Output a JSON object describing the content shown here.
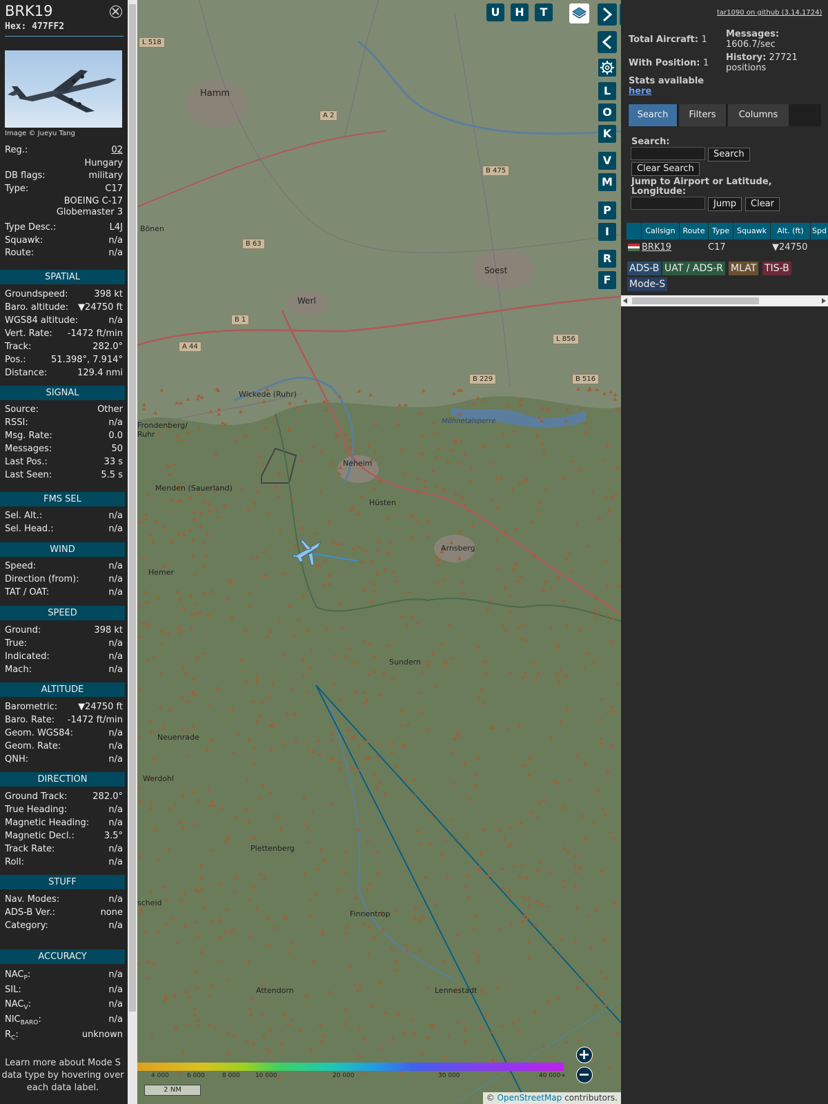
{
  "aircraft": {
    "callsign": "BRK19",
    "hex_label": "Hex:",
    "hex": "477FF2",
    "image_credit": "Image © Jueyu Tang"
  },
  "info": {
    "reg_label": "Reg.:",
    "reg_value": "02",
    "country": "Hungary",
    "dbflags_label": "DB flags:",
    "dbflags_value": "military",
    "type_label": "Type:",
    "type_value": "C17",
    "type_name_1": "BOEING C-17",
    "type_name_2": "Globemaster 3",
    "typedesc_label": "Type Desc.:",
    "typedesc_value": "L4J",
    "squawk_label": "Squawk:",
    "squawk_value": "n/a",
    "route_label": "Route:",
    "route_value": "n/a"
  },
  "sections": {
    "spatial": "SPATIAL",
    "signal": "SIGNAL",
    "fmssel": "FMS SEL",
    "wind": "WIND",
    "speed": "SPEED",
    "altitude": "ALTITUDE",
    "direction": "DIRECTION",
    "stuff": "STUFF",
    "accuracy": "ACCURACY"
  },
  "spatial": [
    {
      "k": "Groundspeed:",
      "v": "398 kt"
    },
    {
      "k": "Baro. altitude:",
      "v": "▼24750 ft"
    },
    {
      "k": "WGS84 altitude:",
      "v": "n/a"
    },
    {
      "k": "Vert. Rate:",
      "v": "-1472 ft/min"
    },
    {
      "k": "Track:",
      "v": "282.0°"
    },
    {
      "k": "Pos.:",
      "v": "51.398°, 7.914°"
    },
    {
      "k": "Distance:",
      "v": "129.4 nmi"
    }
  ],
  "signal": [
    {
      "k": "Source:",
      "v": "Other"
    },
    {
      "k": "RSSI:",
      "v": "n/a"
    },
    {
      "k": "Msg. Rate:",
      "v": "0.0"
    },
    {
      "k": "Messages:",
      "v": "50"
    },
    {
      "k": "Last Pos.:",
      "v": "33 s"
    },
    {
      "k": "Last Seen:",
      "v": "5.5 s"
    }
  ],
  "fmssel": [
    {
      "k": "Sel. Alt.:",
      "v": "n/a"
    },
    {
      "k": "Sel. Head.:",
      "v": "n/a"
    }
  ],
  "wind": [
    {
      "k": "Speed:",
      "v": "n/a"
    },
    {
      "k": "Direction (from):",
      "v": "n/a"
    },
    {
      "k": "TAT / OAT:",
      "v": "n/a"
    }
  ],
  "speed": [
    {
      "k": "Ground:",
      "v": "398 kt"
    },
    {
      "k": "True:",
      "v": "n/a"
    },
    {
      "k": "Indicated:",
      "v": "n/a"
    },
    {
      "k": "Mach:",
      "v": "n/a"
    }
  ],
  "altitude": [
    {
      "k": "Barometric:",
      "v": "▼24750 ft"
    },
    {
      "k": "Baro. Rate:",
      "v": "-1472 ft/min"
    },
    {
      "k": "Geom. WGS84:",
      "v": "n/a"
    },
    {
      "k": "Geom. Rate:",
      "v": "n/a"
    },
    {
      "k": "QNH:",
      "v": "n/a"
    }
  ],
  "direction": [
    {
      "k": "Ground Track:",
      "v": "282.0°"
    },
    {
      "k": "True Heading:",
      "v": "n/a"
    },
    {
      "k": "Magnetic Heading:",
      "v": "n/a"
    },
    {
      "k": "Magnetic Decl.:",
      "v": "3.5°"
    },
    {
      "k": "Track Rate:",
      "v": "n/a"
    },
    {
      "k": "Roll:",
      "v": "n/a"
    }
  ],
  "stuff": [
    {
      "k": "Nav. Modes:",
      "v": "n/a"
    },
    {
      "k": "ADS-B Ver.:",
      "v": "none"
    },
    {
      "k": "Category:",
      "v": "n/a"
    }
  ],
  "accuracy": [
    {
      "k": "NACP:",
      "v": "n/a"
    },
    {
      "k": "SIL:",
      "v": "n/a"
    },
    {
      "k": "NACV:",
      "v": "n/a"
    },
    {
      "k": "NICBARO:",
      "v": "n/a"
    },
    {
      "k": "RC:",
      "v": "unknown"
    }
  ],
  "accuracy_labels": {
    "nacp_main": "NAC",
    "nacp_sub": "P",
    "nacv_main": "NAC",
    "nacv_sub": "V",
    "nic_main": "NIC",
    "nic_sub": "BARO",
    "rc_main": "R",
    "rc_sub": "C"
  },
  "footnote": "Learn more about Mode S data type by hovering over each data label.",
  "map": {
    "toolbar": [
      "U",
      "H",
      "T"
    ],
    "side_buttons": [
      "L",
      "O",
      "K",
      "V",
      "M",
      "P",
      "I",
      "R",
      "F"
    ],
    "places": [
      "Hamm",
      "Bönen",
      "Soest",
      "Werl",
      "Wickede (Ruhr)",
      "Frondenberg/ Ruhr",
      "Neheim",
      "Hüsten",
      "Menden (Sauerland)",
      "Arnsberg",
      "Hemer",
      "Sundern",
      "Neuenrade",
      "Werdohl",
      "Plettenberg",
      "Finnentrop",
      "Attendorn",
      "Lennestadt",
      "Möhnetalsperre",
      "scheid"
    ],
    "roads": [
      "L 518",
      "A 2",
      "B 475",
      "B 63",
      "B 1",
      "A 44",
      "L 856",
      "B 229",
      "B 516"
    ],
    "scale": "2 NM",
    "attribution_prefix": "© ",
    "attribution_link": "OpenStreetMap",
    "attribution_suffix": " contributors.",
    "altitude_ticks": [
      "4 000",
      "6 000",
      "8 000",
      "10 000",
      "20 000",
      "30 000",
      "40 000+"
    ]
  },
  "right": {
    "github": "tar1090 on github (3.14.1724)",
    "total_aircraft_label": "Total Aircraft:",
    "total_aircraft": "1",
    "with_position_label": "With Position:",
    "with_position": "1",
    "messages_label": "Messages:",
    "messages_rate": "1606.7/sec",
    "history_label": "History:",
    "history_value": "27721",
    "history_unit": "positions",
    "stats_text": "Stats available",
    "stats_link": "here",
    "tabs": [
      "Search",
      "Filters",
      "Columns"
    ],
    "search_label": "Search:",
    "search_button": "Search",
    "clear_search_button": "Clear Search",
    "jump_label_1": "Jump to Airport or Latitude,",
    "jump_label_2": "Longitude:",
    "jump_button": "Jump",
    "clear_button": "Clear",
    "table_headers": [
      "Callsign",
      "Route",
      "Type",
      "Squawk",
      "Alt. (ft)",
      "Spd"
    ],
    "table_row": {
      "callsign": "BRK19",
      "route": "",
      "type": "C17",
      "squawk": "",
      "alt": "▼24750"
    },
    "sources": [
      {
        "label": "ADS-B",
        "color": "#2a4a6a"
      },
      {
        "label": "UAT / ADS-R",
        "color": "#2d5a40"
      },
      {
        "label": "MLAT",
        "color": "#6a5030"
      },
      {
        "label": "TIS-B",
        "color": "#6a2a3a"
      },
      {
        "label": "Mode-S",
        "color": "#2a3f5f"
      }
    ]
  },
  "colors": {
    "section_header": "#00495f",
    "panel_bg": "#242424",
    "active_tab": "#3d6fa0",
    "track_line": "#0a5f80"
  }
}
